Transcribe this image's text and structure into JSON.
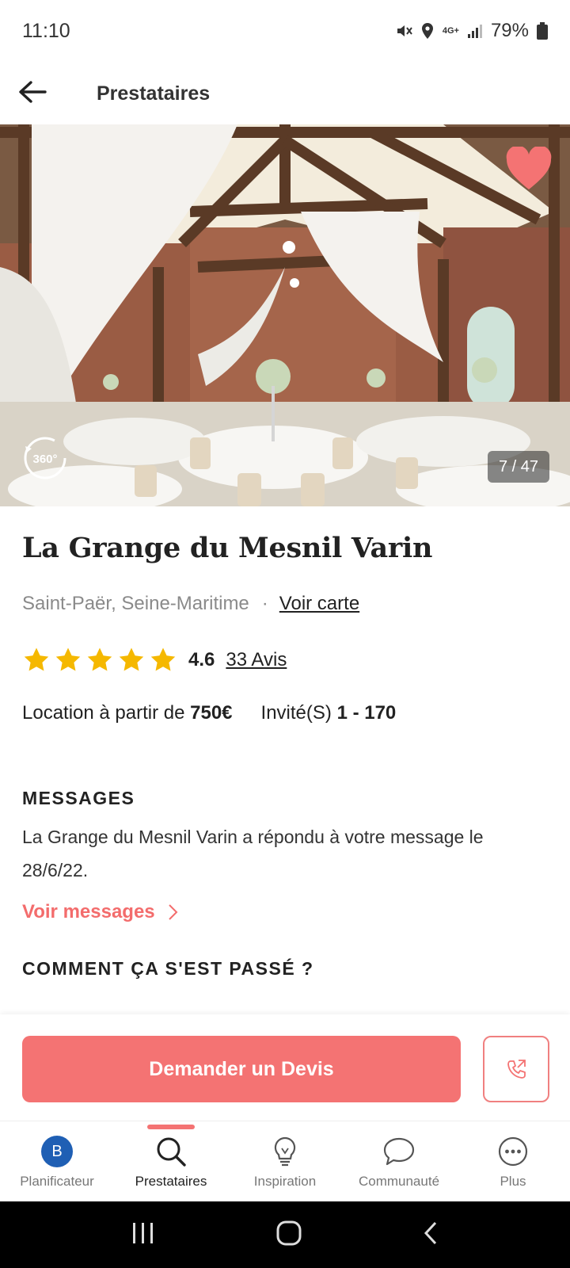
{
  "status_bar": {
    "time": "11:10",
    "network": "4G+",
    "battery": "79%"
  },
  "header": {
    "title": "Prestataires",
    "back_icon": "arrow-left-icon"
  },
  "hero": {
    "photo_counter": "7 / 47",
    "pano_label": "360°",
    "favorite_color": "#f47373"
  },
  "venue": {
    "name": "La Grange du Mesnil Varin",
    "location": "Saint-Paër, Seine-Maritime",
    "separator": "·",
    "map_link": "Voir carte",
    "rating": "4.6",
    "stars": 5,
    "reviews": "33 Avis",
    "price_label": "Location à partir de",
    "price_value": "750€",
    "guests_label": "Invité(S)",
    "guests_value": "1 - 170"
  },
  "messages": {
    "title": "MESSAGES",
    "text": "La Grange du Mesnil Varin a répondu à votre message le 28/6/22.",
    "link": "Voir messages"
  },
  "experience": {
    "title": "COMMENT ÇA S'EST PASSÉ ?"
  },
  "cta": {
    "devis_label": "Demander un Devis",
    "accent": "#f47373"
  },
  "bottom_nav": {
    "items": [
      {
        "label": "Planificateur",
        "icon": "avatar-icon",
        "avatar_letter": "B"
      },
      {
        "label": "Prestataires",
        "icon": "search-icon",
        "active": true
      },
      {
        "label": "Inspiration",
        "icon": "lightbulb-icon"
      },
      {
        "label": "Communauté",
        "icon": "chat-bubble-icon"
      },
      {
        "label": "Plus",
        "icon": "more-icon"
      }
    ]
  }
}
